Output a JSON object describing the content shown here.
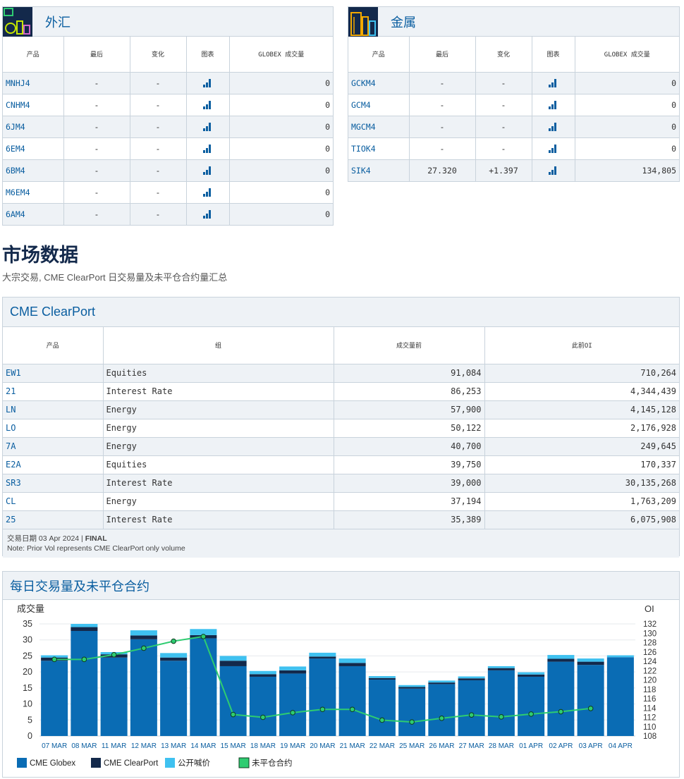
{
  "fx": {
    "title": "外汇",
    "headers": [
      "产品",
      "最后",
      "变化",
      "图表",
      "GLOBEX 成交量"
    ],
    "rows": [
      {
        "sym": "MNHJ4",
        "last": "-",
        "chg": "-",
        "vol": "0"
      },
      {
        "sym": "CNHM4",
        "last": "-",
        "chg": "-",
        "vol": "0"
      },
      {
        "sym": "6JM4",
        "last": "-",
        "chg": "-",
        "vol": "0"
      },
      {
        "sym": "6EM4",
        "last": "-",
        "chg": "-",
        "vol": "0"
      },
      {
        "sym": "6BM4",
        "last": "-",
        "chg": "-",
        "vol": "0"
      },
      {
        "sym": "M6EM4",
        "last": "-",
        "chg": "-",
        "vol": "0"
      },
      {
        "sym": "6AM4",
        "last": "-",
        "chg": "-",
        "vol": "0"
      }
    ]
  },
  "metals": {
    "title": "金属",
    "headers": [
      "产品",
      "最后",
      "变化",
      "图表",
      "GLOBEX 成交量"
    ],
    "rows": [
      {
        "sym": "GCKM4",
        "last": "-",
        "chg": "-",
        "vol": "0"
      },
      {
        "sym": "GCM4",
        "last": "-",
        "chg": "-",
        "vol": "0"
      },
      {
        "sym": "MGCM4",
        "last": "-",
        "chg": "-",
        "vol": "0"
      },
      {
        "sym": "TIOK4",
        "last": "-",
        "chg": "-",
        "vol": "0"
      },
      {
        "sym": "SIK4",
        "last": "27.320",
        "chg": "+1.397",
        "vol": "134,805"
      }
    ]
  },
  "market": {
    "title": "市场数据",
    "subtitle": "大宗交易, CME ClearPort 日交易量及未平仓合约量汇总"
  },
  "clearport": {
    "title": "CME ClearPort",
    "headers": [
      "产品",
      "组",
      "成交量前",
      "此前OI"
    ],
    "rows": [
      {
        "sym": "EW1",
        "group": "Equities",
        "vol": "91,084",
        "oi": "710,264"
      },
      {
        "sym": "21",
        "group": "Interest Rate",
        "vol": "86,253",
        "oi": "4,344,439"
      },
      {
        "sym": "LN",
        "group": "Energy",
        "vol": "57,900",
        "oi": "4,145,128"
      },
      {
        "sym": "LO",
        "group": "Energy",
        "vol": "50,122",
        "oi": "2,176,928"
      },
      {
        "sym": "7A",
        "group": "Energy",
        "vol": "40,700",
        "oi": "249,645"
      },
      {
        "sym": "E2A",
        "group": "Equities",
        "vol": "39,750",
        "oi": "170,337"
      },
      {
        "sym": "SR3",
        "group": "Interest Rate",
        "vol": "39,000",
        "oi": "30,135,268"
      },
      {
        "sym": "CL",
        "group": "Energy",
        "vol": "37,194",
        "oi": "1,763,209"
      },
      {
        "sym": "25",
        "group": "Interest Rate",
        "vol": "35,389",
        "oi": "6,075,908"
      }
    ],
    "date_label": "交易日期 03 Apr 2024 | ",
    "status": "FINAL",
    "note": "Note: Prior Vol represents CME ClearPort only volume"
  },
  "daily": {
    "title": "每日交易量及未平仓合约"
  },
  "colors": {
    "globex": "#0a6cb4",
    "clearport": "#13294b",
    "open_outcry": "#3fc1f0",
    "oi_line": "#2ecc71",
    "oi_dot": "#16a34a"
  },
  "chart_data": {
    "type": "bar",
    "ylabel": "成交量",
    "y2label": "OI",
    "ylim": [
      0,
      35
    ],
    "y2lim": [
      108,
      132
    ],
    "yticks": [
      0,
      5,
      10,
      15,
      20,
      25,
      30,
      35
    ],
    "y2ticks": [
      108,
      110,
      112,
      114,
      116,
      118,
      120,
      122,
      124,
      126,
      128,
      130,
      132
    ],
    "categories": [
      "07 MAR",
      "08 MAR",
      "11 MAR",
      "12 MAR",
      "13 MAR",
      "14 MAR",
      "15 MAR",
      "18 MAR",
      "19 MAR",
      "20 MAR",
      "21 MAR",
      "22 MAR",
      "25 MAR",
      "26 MAR",
      "27 MAR",
      "28 MAR",
      "01 APR",
      "02 APR",
      "03 APR",
      "04 APR"
    ],
    "series": [
      {
        "name": "CME Globex",
        "values": [
          23.5,
          32.8,
          24.5,
          30.2,
          23.5,
          30.5,
          21.8,
          18.5,
          19.5,
          24.2,
          21.8,
          17.6,
          14.8,
          16.2,
          17.4,
          20.5,
          18.5,
          23.2,
          22.2,
          24.6
        ]
      },
      {
        "name": "CME ClearPort",
        "values": [
          1.0,
          1.2,
          1.0,
          1.2,
          1.0,
          1.0,
          1.7,
          0.8,
          1.0,
          0.6,
          1.0,
          0.5,
          0.5,
          0.5,
          0.6,
          0.7,
          0.7,
          0.9,
          1.0,
          0.0
        ]
      },
      {
        "name": "公开喊价",
        "values": [
          0.7,
          1.0,
          0.7,
          1.6,
          1.4,
          1.9,
          1.5,
          1.0,
          1.2,
          1.2,
          1.4,
          0.6,
          0.6,
          0.6,
          0.6,
          0.6,
          0.7,
          1.2,
          1.0,
          0.6
        ]
      },
      {
        "name": "未平仓合约",
        "values": [
          124.4,
          124.4,
          125.4,
          126.8,
          128.3,
          129.3,
          112.6,
          112.0,
          113.0,
          113.7,
          113.7,
          111.4,
          111.0,
          111.8,
          112.5,
          112.1,
          112.7,
          113.2,
          113.9,
          null
        ]
      }
    ],
    "legend": [
      "CME Globex",
      "CME ClearPort",
      "公开喊价",
      "未平仓合约"
    ],
    "grid": true
  }
}
